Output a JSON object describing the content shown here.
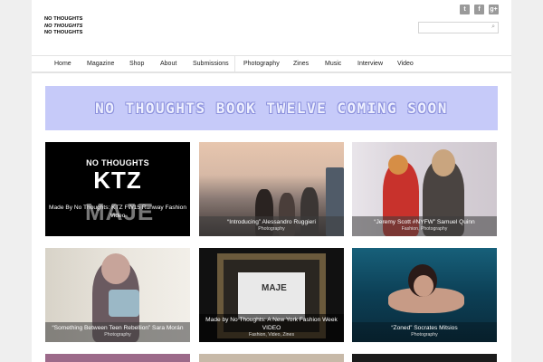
{
  "site": {
    "logo_lines": [
      "NO THOUGHTS",
      "NO THOUGHTS",
      "NO THOUGHTS"
    ]
  },
  "social": [
    "t",
    "f",
    "g+"
  ],
  "nav": [
    "Home",
    "Magazine",
    "Shop",
    "About",
    "Submissions",
    "Photography",
    "Zines",
    "Music",
    "Interview",
    "Video"
  ],
  "banner": {
    "text": "NO  THOUGHTS BOOK TWELVE COMING SOON"
  },
  "tiles": [
    {
      "title": "Made By No Thoughts: KTZ FW15 Runway Fashion Video",
      "cats": "",
      "art_top": "NO THOUGHTS",
      "art_mid": "KTZ",
      "art_bottom": "MAJE"
    },
    {
      "title": "“Introducing” Alessandro Ruggieri",
      "cats": "Photography"
    },
    {
      "title": "“Jeremy Scott #NYFW” Samuel Quinn",
      "cats": "Fashion, Photography"
    },
    {
      "title": "“Something Between Teen Rebellion” Sara Morán",
      "cats": "Photography"
    },
    {
      "title": "Made by No Thoughts: A New York Fashion Week VIDEO",
      "cats": "Fashion, Video, Zines",
      "art": "MAJE"
    },
    {
      "title": "“Zoned” Socrates Mitsios",
      "cats": "Photography"
    }
  ]
}
